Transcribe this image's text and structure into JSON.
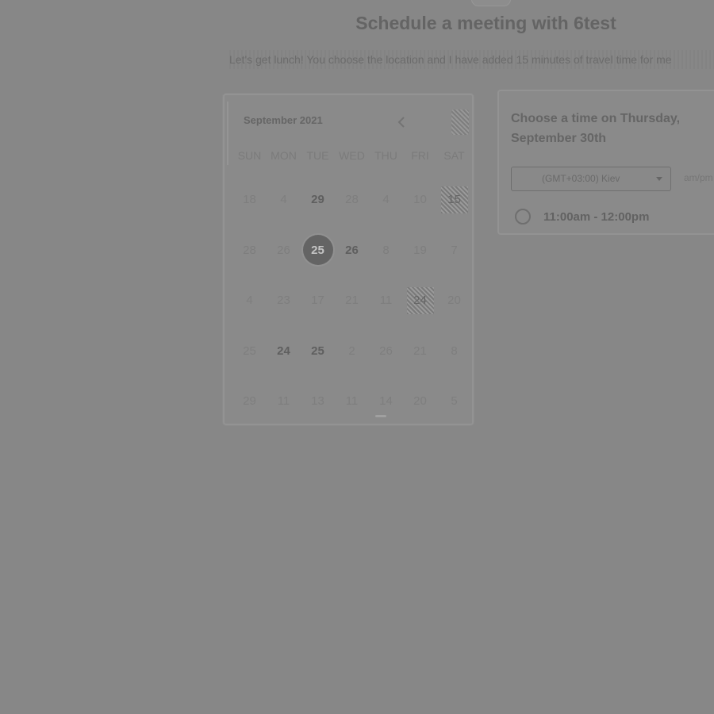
{
  "header": {
    "title": "Schedule a meeting with 6test",
    "subtitle": "Let's get lunch! You choose the location and I have added 15 minutes of travel time for me"
  },
  "calendar": {
    "month_label": "September 2021",
    "weekdays": [
      "SUN",
      "MON",
      "TUE",
      "WED",
      "THU",
      "FRI",
      "SAT"
    ],
    "weeks": [
      [
        {
          "label": "18",
          "state": "disabled"
        },
        {
          "label": "4",
          "state": "disabled"
        },
        {
          "label": "29",
          "state": "available"
        },
        {
          "label": "28",
          "state": "disabled"
        },
        {
          "label": "4",
          "state": "disabled"
        },
        {
          "label": "10",
          "state": "disabled"
        },
        {
          "label": "15",
          "state": "noisy"
        }
      ],
      [
        {
          "label": "28",
          "state": "disabled"
        },
        {
          "label": "26",
          "state": "disabled"
        },
        {
          "label": "25",
          "state": "selected"
        },
        {
          "label": "26",
          "state": "available"
        },
        {
          "label": "8",
          "state": "disabled"
        },
        {
          "label": "19",
          "state": "disabled"
        },
        {
          "label": "7",
          "state": "disabled"
        }
      ],
      [
        {
          "label": "4",
          "state": "disabled"
        },
        {
          "label": "23",
          "state": "disabled"
        },
        {
          "label": "17",
          "state": "disabled"
        },
        {
          "label": "21",
          "state": "disabled"
        },
        {
          "label": "11",
          "state": "disabled"
        },
        {
          "label": "24",
          "state": "noisy"
        },
        {
          "label": "20",
          "state": "disabled"
        }
      ],
      [
        {
          "label": "25",
          "state": "disabled"
        },
        {
          "label": "24",
          "state": "available"
        },
        {
          "label": "25",
          "state": "available"
        },
        {
          "label": "2",
          "state": "disabled"
        },
        {
          "label": "26",
          "state": "disabled"
        },
        {
          "label": "21",
          "state": "disabled"
        },
        {
          "label": "8",
          "state": "disabled"
        }
      ],
      [
        {
          "label": "29",
          "state": "disabled"
        },
        {
          "label": "11",
          "state": "disabled"
        },
        {
          "label": "13",
          "state": "disabled"
        },
        {
          "label": "11",
          "state": "disabled"
        },
        {
          "label": "14",
          "state": "disabled"
        },
        {
          "label": "20",
          "state": "disabled"
        },
        {
          "label": "5",
          "state": "disabled"
        }
      ]
    ],
    "prev_icon": "chevron-left-icon",
    "next_icon": "chevron-right-icon"
  },
  "time_panel": {
    "title": "Choose a time on Thursday, September 30th",
    "timezone": "(GMT+03:00) Kiev",
    "format_toggle": "am/pm",
    "slots": [
      "11:00am - 12:00pm"
    ]
  }
}
